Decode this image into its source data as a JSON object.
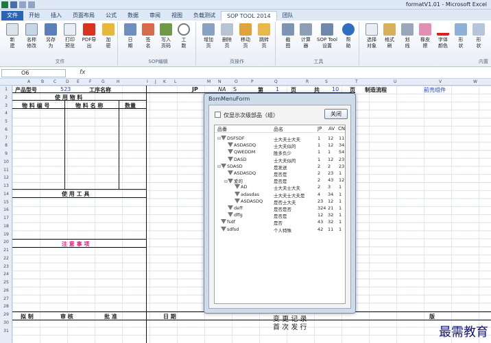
{
  "window": {
    "title": "formatV1.01 - Microsoft Excel"
  },
  "tabs": [
    "文件",
    "开始",
    "插入",
    "页面布局",
    "公式",
    "数据",
    "审阅",
    "视图",
    "负载测试",
    "SOP TOOL 2014",
    "团队"
  ],
  "ribbon": {
    "groups": [
      {
        "label": "文件",
        "buttons": [
          "新\n建",
          "名称\n修改",
          "另存\n为",
          "打印\n预览",
          "PDF导\n出",
          "加\n密"
        ]
      },
      {
        "label": "SOP编辑",
        "buttons": [
          "日\n期",
          "签\n名",
          "写入\n页码",
          "工\n数"
        ]
      },
      {
        "label": "页操作",
        "buttons": [
          "增加\n页",
          "删除\n页",
          "移动\n页",
          "跳转\n页"
        ]
      },
      {
        "label": "工具",
        "buttons": [
          "截\n图",
          "计算\n器",
          "SOP Tool\n设置",
          "帮\n助"
        ]
      },
      {
        "label": "内置",
        "buttons": [
          "选择\n对象",
          "格式\n刷",
          "划\n线",
          "橡皮\n擦",
          "字体\n颜色",
          "形\n状",
          "形\n状"
        ]
      }
    ]
  },
  "formula_bar": {
    "name_box": "O6",
    "fx": "fx"
  },
  "sheet": {
    "columns": [
      "A",
      "B",
      "C",
      "D",
      "E",
      "F",
      "G",
      "H",
      "I",
      "J",
      "K",
      "L",
      "M",
      "N",
      "O",
      "P",
      "Q",
      "R",
      "S",
      "T",
      "U",
      "V",
      "W"
    ],
    "rows": [
      "1",
      "2",
      "3",
      "4",
      "5",
      "6",
      "7",
      "8",
      "9",
      "10",
      "11",
      "12",
      "13",
      "14",
      "15",
      "16",
      "17",
      "18",
      "19",
      "20",
      "21",
      "22",
      "23",
      "24",
      "25",
      "26",
      "27",
      "28",
      "29",
      "30",
      "31"
    ],
    "cells": {
      "product_model_label": "产品型号",
      "product_model_value": "523",
      "process_name_label": "工序名称",
      "jp": "JP",
      "na": "NA",
      "s": "S",
      "di": "第",
      "page_no": "1",
      "ye1": "页",
      "gong": "共",
      "total": "10",
      "ye2": "页",
      "process_flow": "制造流程",
      "front_shell": "前壳组件",
      "use_material": "使 用 物 料",
      "material_no": "物 料 编 号",
      "material_name": "物 料 名 称",
      "quantity": "数量",
      "use_tools": "使 用 工 具",
      "notes": "注 意 事 项",
      "draft": "拟 制",
      "review": "审 核",
      "approve": "批 准",
      "date": "日 期",
      "change": "变 更 记 录",
      "first": "首 次 发 行",
      "rev": "版"
    }
  },
  "dialog": {
    "title": "BomMenuForm",
    "checkbox_label": "仅显示次级部品（组）",
    "close_button": "关闭",
    "headers": [
      "品番",
      "品名",
      "JP",
      "AV",
      "CN"
    ],
    "rows": [
      {
        "depth": 0,
        "exp": "⊟",
        "code": "DSFSDF",
        "name": "士大夫士大夫",
        "jp": "1",
        "av": "12",
        "cn": "11"
      },
      {
        "depth": 1,
        "exp": "",
        "code": "ASDASDQ",
        "name": "士大夫似的",
        "jp": "1",
        "av": "12",
        "cn": "34"
      },
      {
        "depth": 1,
        "exp": "",
        "code": "QWEDDM",
        "name": "胜多负少",
        "jp": "1",
        "av": "1",
        "cn": "54"
      },
      {
        "depth": 1,
        "exp": "",
        "code": "DASD",
        "name": "士大夫似的",
        "jp": "1",
        "av": "12",
        "cn": "23"
      },
      {
        "depth": 0,
        "exp": "⊟",
        "code": "SDASD",
        "name": "是发送",
        "jp": "2",
        "av": "2",
        "cn": "23"
      },
      {
        "depth": 1,
        "exp": "",
        "code": "ASDASDQ",
        "name": "是否是",
        "jp": "2",
        "av": "23",
        "cn": "1"
      },
      {
        "depth": 1,
        "exp": "⊟",
        "code": "爱的",
        "name": "是否是",
        "jp": "2",
        "av": "43",
        "cn": "12"
      },
      {
        "depth": 2,
        "exp": "",
        "code": "AD",
        "name": "士大夫士大夫",
        "jp": "2",
        "av": "3",
        "cn": "1"
      },
      {
        "depth": 2,
        "exp": "",
        "code": "adasdas",
        "name": "士大夫士大夫是",
        "jp": "4",
        "av": "34",
        "cn": "1"
      },
      {
        "depth": 2,
        "exp": "",
        "code": "ASDASDQ",
        "name": "是否士大夫",
        "jp": "23",
        "av": "12",
        "cn": "1"
      },
      {
        "depth": 1,
        "exp": "",
        "code": "deff",
        "name": "是否是否",
        "jp": "324",
        "av": "21",
        "cn": "1"
      },
      {
        "depth": 1,
        "exp": "",
        "code": "dffg",
        "name": "是否是",
        "jp": "12",
        "av": "32",
        "cn": "1"
      },
      {
        "depth": 0,
        "exp": "",
        "code": "fsdf",
        "name": "是否",
        "jp": "43",
        "av": "32",
        "cn": "1"
      },
      {
        "depth": 0,
        "exp": "",
        "code": "sdfsd",
        "name": "个人特殊",
        "jp": "42",
        "av": "11",
        "cn": "1"
      }
    ]
  },
  "watermark": "最需教育"
}
